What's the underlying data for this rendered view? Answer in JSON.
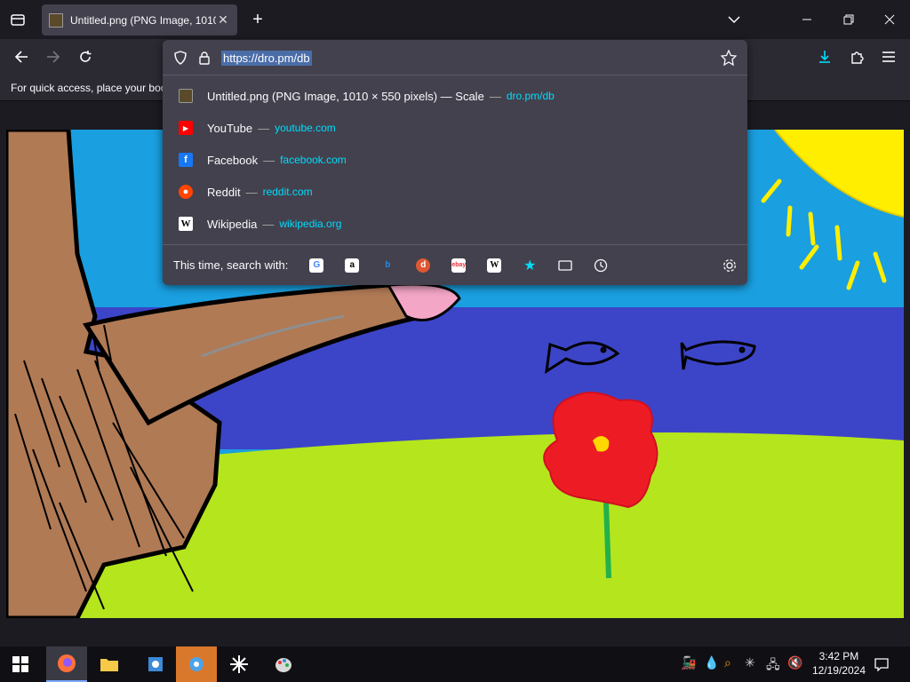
{
  "browser": {
    "tab_title": "Untitled.png (PNG Image, 1010",
    "url_text": "https://dro.pm/db",
    "bookmarks_hint": "For quick access, place your boo"
  },
  "suggestions": [
    {
      "icon": "image-file-icon",
      "title": "Untitled.png (PNG Image, 1010 × 550 pixels) — Scale",
      "sep": "—",
      "link": "dro.pm/db"
    },
    {
      "icon": "youtube-icon",
      "title": "YouTube",
      "sep": "—",
      "link": "youtube.com"
    },
    {
      "icon": "facebook-icon",
      "title": "Facebook",
      "sep": "—",
      "link": "facebook.com"
    },
    {
      "icon": "reddit-icon",
      "title": "Reddit",
      "sep": "—",
      "link": "reddit.com"
    },
    {
      "icon": "wikipedia-icon",
      "title": "Wikipedia",
      "sep": "—",
      "link": "wikipedia.org"
    }
  ],
  "search_with": {
    "label": "This time, search with:",
    "engines": [
      "google-icon",
      "amazon-icon",
      "bing-icon",
      "duckduckgo-icon",
      "ebay-icon",
      "wikipedia-icon",
      "bookmarks-star-icon",
      "tabs-icon",
      "history-icon"
    ]
  },
  "taskbar": {
    "time": "3:42 PM",
    "date": "12/19/2024"
  },
  "colors": {
    "accent": "#00ddff",
    "panel": "#42414d",
    "sky": "#1a9fe0",
    "water": "#3c45c8",
    "grass": "#b5e51d",
    "sun": "#ffee00"
  }
}
